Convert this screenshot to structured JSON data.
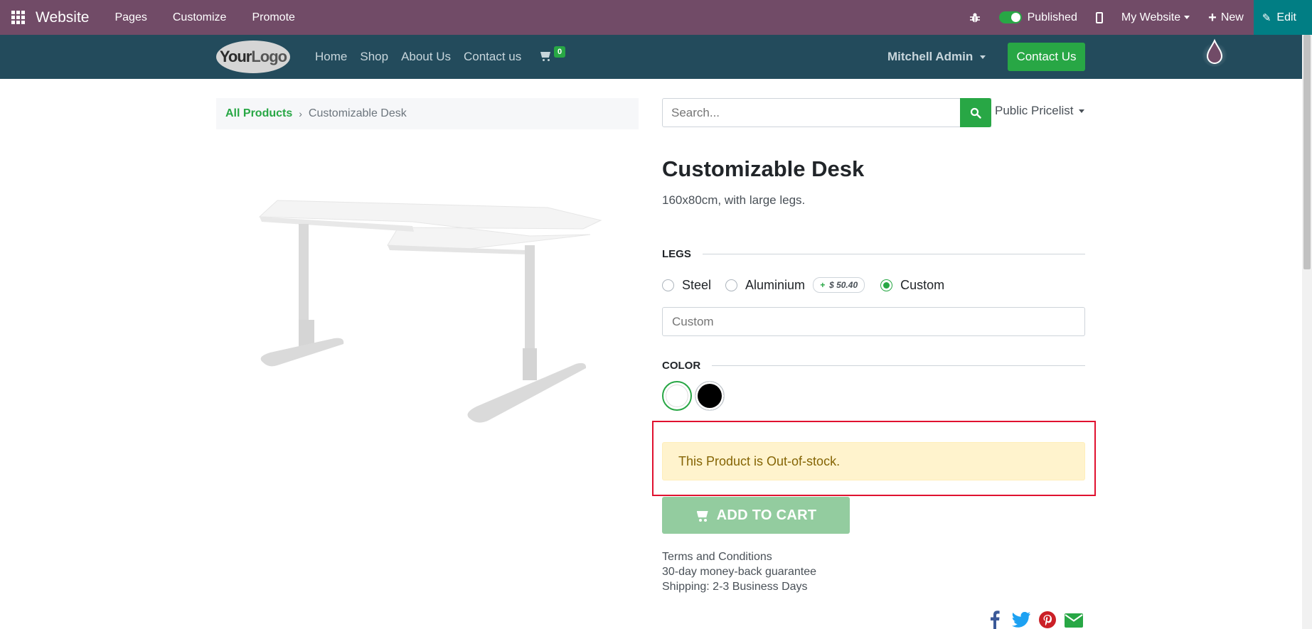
{
  "adminbar": {
    "brand": "Website",
    "menu": [
      "Pages",
      "Customize",
      "Promote"
    ],
    "published_label": "Published",
    "website_selector": "My Website",
    "new_label": "New",
    "edit_label": "Edit",
    "color": "#714b67"
  },
  "sitenav": {
    "logo": {
      "your": "Your",
      "logo": "Logo"
    },
    "links": [
      "Home",
      "Shop",
      "About Us",
      "Contact us"
    ],
    "cart_count": "0",
    "user": "Mitchell Admin",
    "contact_button": "Contact Us",
    "color": "#234b5c"
  },
  "breadcrumb": {
    "parent": "All Products",
    "current": "Customizable Desk"
  },
  "search": {
    "placeholder": "Search..."
  },
  "pricelist": "Public Pricelist",
  "product": {
    "name": "Customizable Desk",
    "description": "160x80cm, with large legs.",
    "legs": {
      "label": "LEGS",
      "options": [
        {
          "label": "Steel",
          "checked": false
        },
        {
          "label": "Aluminium",
          "checked": false,
          "extra_prefix": "+",
          "extra_price": "$ 50.40"
        },
        {
          "label": "Custom",
          "checked": true
        }
      ],
      "custom_value_placeholder": "Custom"
    },
    "color": {
      "label": "COLOR",
      "swatches": [
        {
          "name": "white",
          "hex": "#ffffff",
          "selected": true
        },
        {
          "name": "black",
          "hex": "#000000",
          "selected": false
        }
      ]
    },
    "stock_alert": "This Product is Out-of-stock.",
    "add_to_cart": "ADD TO CART",
    "terms": [
      "Terms and Conditions",
      "30-day money-back guarantee",
      "Shipping: 2-3 Business Days"
    ]
  },
  "share": {
    "icons": [
      "facebook-icon",
      "twitter-icon",
      "pinterest-icon",
      "email-icon"
    ]
  }
}
